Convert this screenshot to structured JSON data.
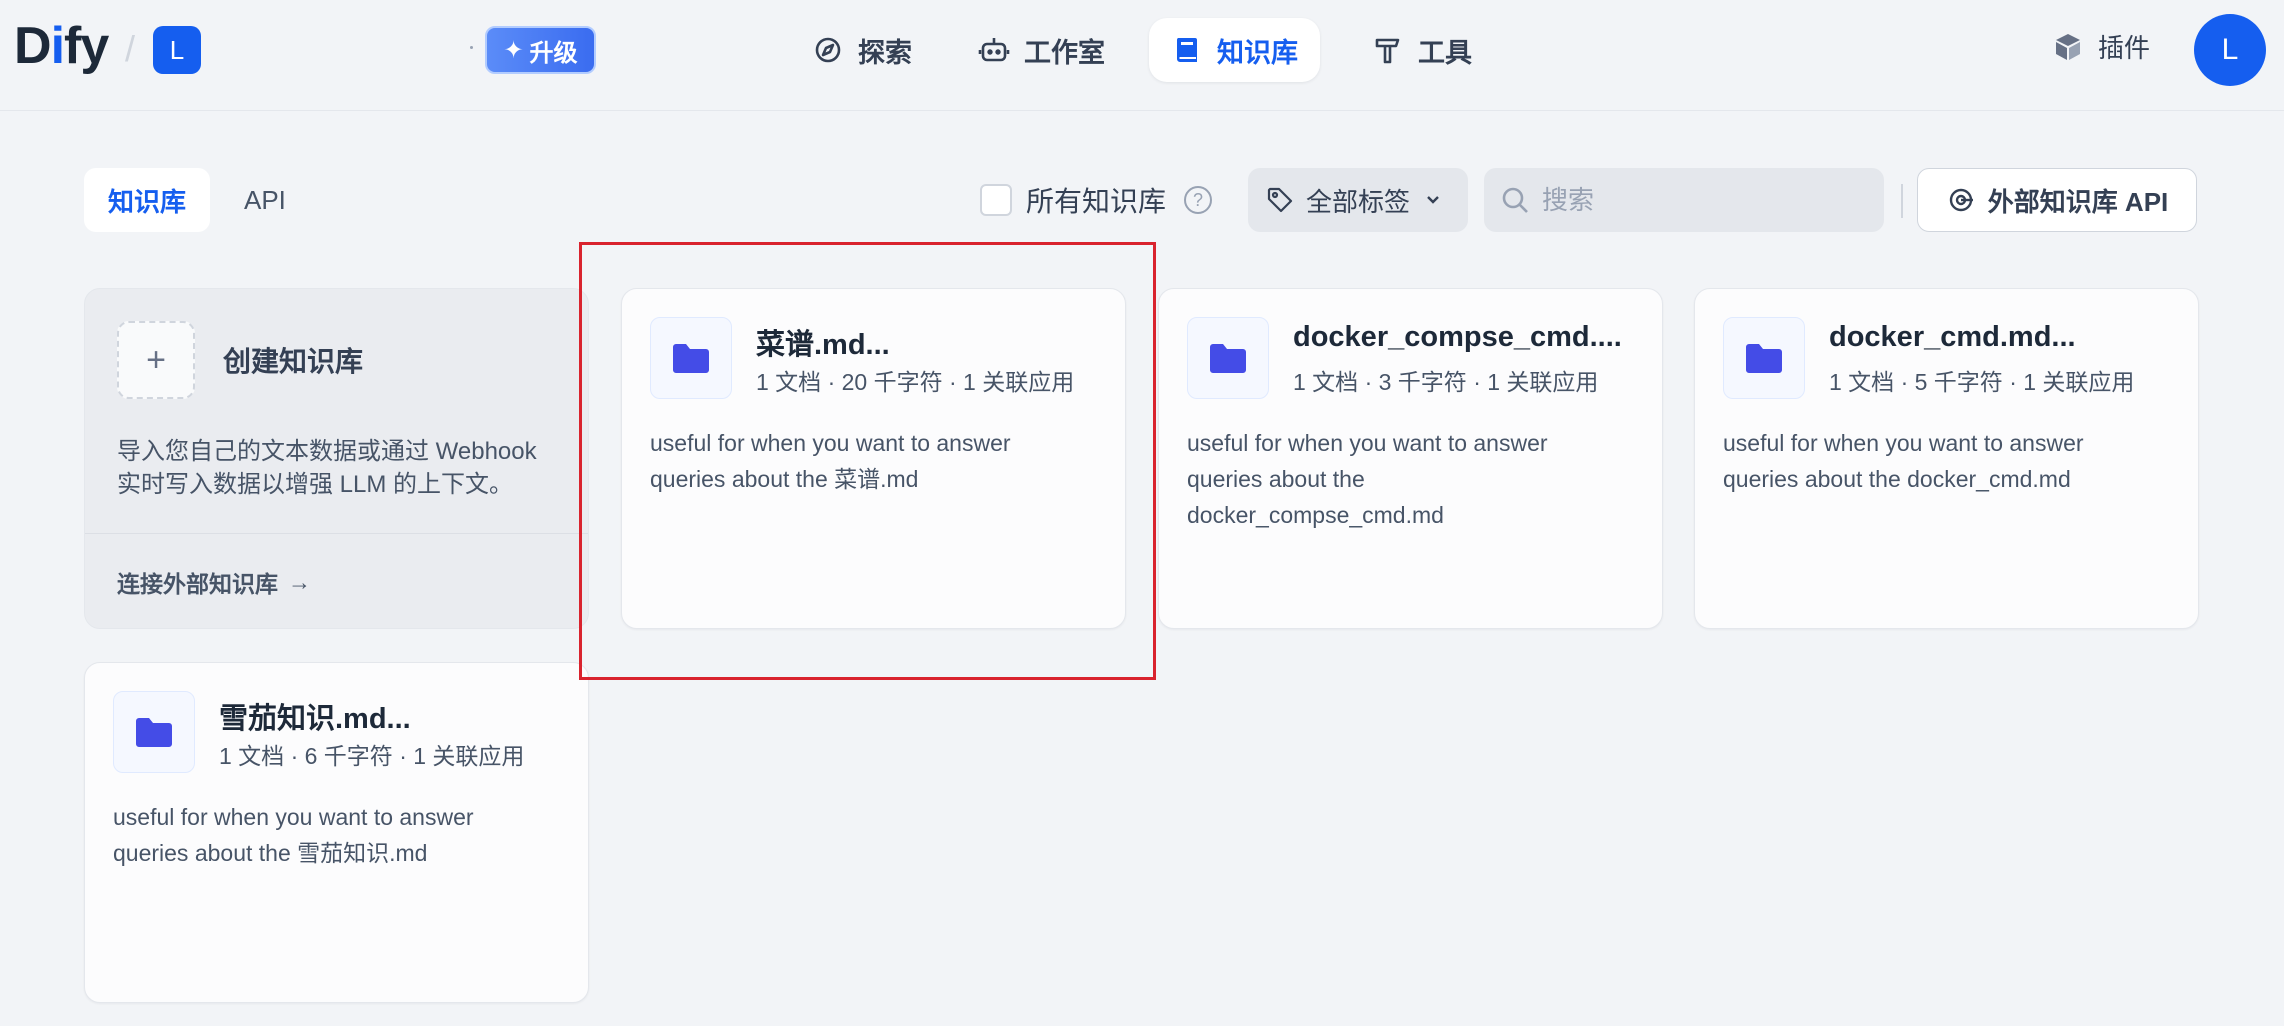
{
  "header": {
    "logo_d": "D",
    "logo_i": "i",
    "logo_rest": "fy",
    "workspace_initial": "L",
    "upgrade_label": "升级",
    "nav": [
      {
        "label": "探索",
        "icon": "compass-icon"
      },
      {
        "label": "工作室",
        "icon": "robot-icon"
      },
      {
        "label": "知识库",
        "icon": "book-icon",
        "active": true
      },
      {
        "label": "工具",
        "icon": "hammer-icon"
      }
    ],
    "plugins_label": "插件",
    "user_initial": "L"
  },
  "toolbar": {
    "tabs": [
      {
        "label": "知识库",
        "active": true
      },
      {
        "label": "API",
        "active": false
      }
    ],
    "all_kb_label": "所有知识库",
    "tags_label": "全部标签",
    "search_placeholder": "搜索",
    "external_api_label": "外部知识库 API"
  },
  "create_card": {
    "title": "创建知识库",
    "description": "导入您自己的文本数据或通过 Webhook 实时写入数据以增强 LLM 的上下文。",
    "connect_label": "连接外部知识库"
  },
  "knowledge_bases": [
    {
      "title": "菜谱.md...",
      "meta": "1 文档 · 20 千字符 · 1 关联应用",
      "description": "useful for when you want to answer queries about the 菜谱.md"
    },
    {
      "title": "docker_compse_cmd....",
      "meta": "1 文档 · 3 千字符 · 1 关联应用",
      "description": "useful for when you want to answer queries about the docker_compse_cmd.md"
    },
    {
      "title": "docker_cmd.md...",
      "meta": "1 文档 · 5 千字符 · 1 关联应用",
      "description": "useful for when you want to answer queries about the docker_cmd.md"
    },
    {
      "title": "雪茄知识.md...",
      "meta": "1 文档 · 6 千字符 · 1 关联应用",
      "description": "useful for when you want to answer queries about the 雪茄知识.md"
    }
  ],
  "colors": {
    "accent": "#155eef",
    "folder": "#444ce7",
    "highlight": "#d9232e"
  }
}
